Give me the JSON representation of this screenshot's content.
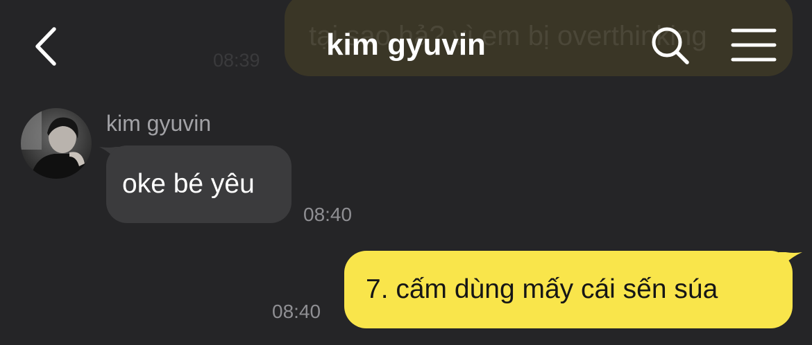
{
  "header": {
    "title": "kim gyuvin",
    "back_icon": "chevron-left-icon",
    "search_icon": "search-icon",
    "menu_icon": "hamburger-menu-icon"
  },
  "previous_message": {
    "text": "tại sao hả? vì em bị overthinking",
    "time": "08:39"
  },
  "messages": [
    {
      "direction": "incoming",
      "sender": "kim gyuvin",
      "text": "oke bé yêu",
      "time": "08:40"
    },
    {
      "direction": "outgoing",
      "text": "7. cấm dùng mấy cái sến súa",
      "time": "08:40"
    }
  ],
  "colors": {
    "background": "#252527",
    "incoming_bubble": "#3b3b3d",
    "outgoing_bubble": "#f9e54b",
    "timestamp": "#8f8f93"
  }
}
